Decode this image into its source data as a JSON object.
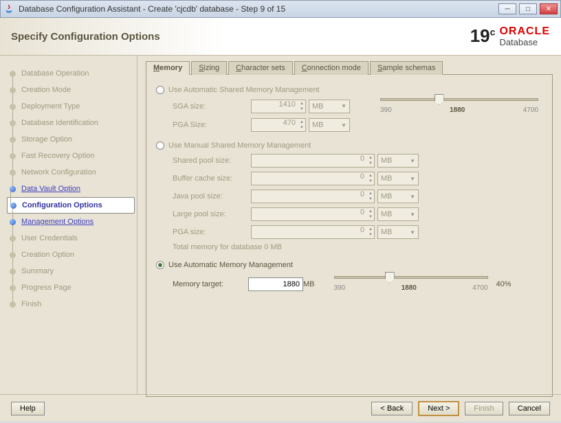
{
  "window": {
    "title": "Database Configuration Assistant - Create 'cjcdb' database - Step 9 of 15"
  },
  "header": {
    "title": "Specify Configuration Options",
    "version": "19",
    "sup": "c",
    "brand": "ORACLE",
    "sub": "Database"
  },
  "sidebar": {
    "items": [
      {
        "label": "Database Operation",
        "state": "dim"
      },
      {
        "label": "Creation Mode",
        "state": "dim"
      },
      {
        "label": "Deployment Type",
        "state": "dim"
      },
      {
        "label": "Database Identification",
        "state": "dim"
      },
      {
        "label": "Storage Option",
        "state": "dim"
      },
      {
        "label": "Fast Recovery Option",
        "state": "dim"
      },
      {
        "label": "Network Configuration",
        "state": "dim"
      },
      {
        "label": "Data Vault Option",
        "state": "link"
      },
      {
        "label": "Configuration Options",
        "state": "current"
      },
      {
        "label": "Management Options",
        "state": "link"
      },
      {
        "label": "User Credentials",
        "state": "dim"
      },
      {
        "label": "Creation Option",
        "state": "dim"
      },
      {
        "label": "Summary",
        "state": "dim"
      },
      {
        "label": "Progress Page",
        "state": "dim"
      },
      {
        "label": "Finish",
        "state": "dim"
      }
    ]
  },
  "tabs": [
    "Memory",
    "Sizing",
    "Character sets",
    "Connection mode",
    "Sample schemas"
  ],
  "mem": {
    "opt1": "Use Automatic Shared Memory Management",
    "sga_lbl": "SGA size:",
    "sga_val": "1410",
    "sga_unit": "MB",
    "pga_lbl": "PGA Size:",
    "pga_val": "470",
    "pga_unit": "MB",
    "slider1": {
      "min": "390",
      "val": "1880",
      "max": "4700"
    },
    "opt2": "Use Manual Shared Memory Management",
    "rows": [
      {
        "lbl": "Shared pool size:",
        "val": "0",
        "unit": "MB"
      },
      {
        "lbl": "Buffer cache size:",
        "val": "0",
        "unit": "MB"
      },
      {
        "lbl": "Java pool size:",
        "val": "0",
        "unit": "MB"
      },
      {
        "lbl": "Large pool size:",
        "val": "0",
        "unit": "MB"
      },
      {
        "lbl": "PGA size:",
        "val": "0",
        "unit": "MB"
      }
    ],
    "total": "Total memory for database 0 MB",
    "opt3": "Use Automatic Memory Management",
    "target_lbl": "Memory target:",
    "target_val": "1880",
    "target_unit": "MB",
    "slider2": {
      "min": "390",
      "val": "1880",
      "max": "4700"
    },
    "pct": "40%"
  },
  "footer": {
    "help": "Help",
    "back": "< Back",
    "next": "Next >",
    "finish": "Finish",
    "cancel": "Cancel"
  }
}
